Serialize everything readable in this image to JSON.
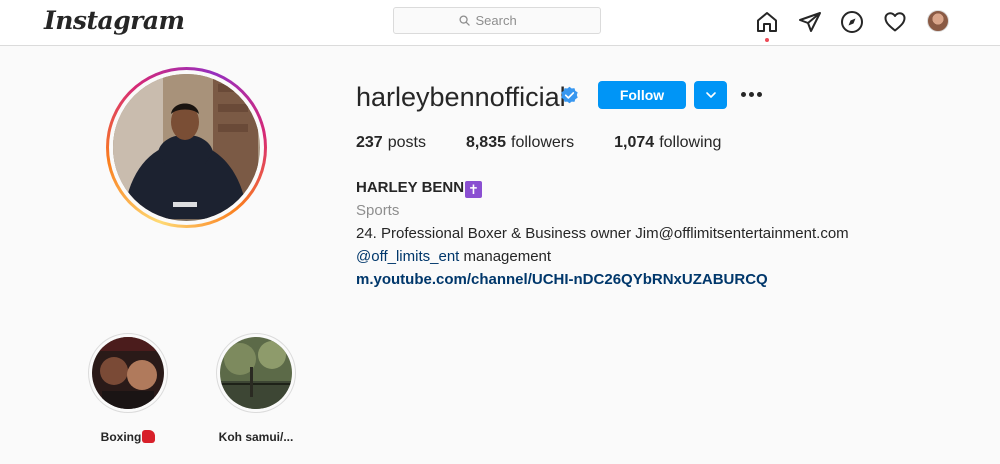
{
  "app": {
    "logo": "Instagram"
  },
  "search": {
    "placeholder": "Search"
  },
  "nav": {
    "icons": [
      "home-icon",
      "direct-icon",
      "explore-icon",
      "activity-icon",
      "profile-avatar"
    ]
  },
  "profile": {
    "username": "harleybennofficial",
    "verified": true,
    "follow_label": "Follow",
    "stats": {
      "posts_count": "237",
      "posts_label": "posts",
      "followers_count": "8,835",
      "followers_label": "followers",
      "following_count": "1,074",
      "following_label": "following"
    },
    "bio": {
      "name": "HARLEY BENN",
      "name_emoji": "✝",
      "category": "Sports",
      "line1": "24. Professional Boxer & Business owner Jim@offlimitsentertainment.com",
      "mention": "@off_limits_ent",
      "line2_rest": " management",
      "link": "m.youtube.com/channel/UCHI-nDC26QYbRNxUZABURCQ"
    }
  },
  "highlights": [
    {
      "label": "Boxing",
      "emoji": "boxing-glove"
    },
    {
      "label": "Koh samui/..."
    }
  ],
  "colors": {
    "accent": "#0095f6",
    "link": "#00376b",
    "notification_dot": "#ed4956"
  }
}
